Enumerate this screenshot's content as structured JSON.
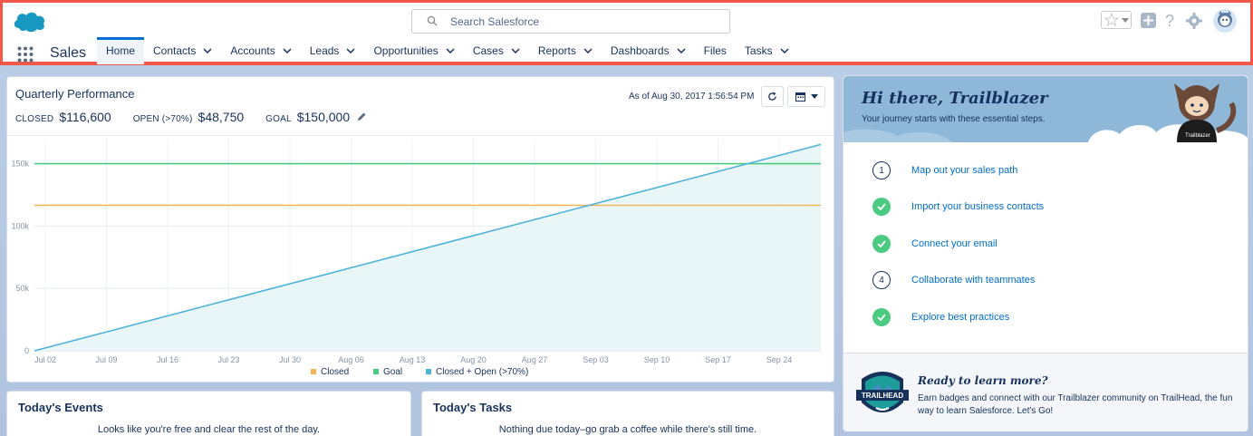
{
  "header": {
    "search_placeholder": "Search Salesforce",
    "app_name": "Sales",
    "utility_icons": [
      "star-icon",
      "plus-icon",
      "help-icon",
      "gear-icon",
      "avatar"
    ]
  },
  "nav": {
    "tabs": [
      {
        "label": "Home",
        "has_menu": false,
        "active": true
      },
      {
        "label": "Contacts",
        "has_menu": true
      },
      {
        "label": "Accounts",
        "has_menu": true
      },
      {
        "label": "Leads",
        "has_menu": true
      },
      {
        "label": "Opportunities",
        "has_menu": true
      },
      {
        "label": "Cases",
        "has_menu": true
      },
      {
        "label": "Reports",
        "has_menu": true
      },
      {
        "label": "Dashboards",
        "has_menu": true
      },
      {
        "label": "Files",
        "has_menu": false
      },
      {
        "label": "Tasks",
        "has_menu": true
      }
    ]
  },
  "performance": {
    "title": "Quarterly Performance",
    "closed_label": "CLOSED",
    "closed_value": "$116,600",
    "open_label": "OPEN (>70%)",
    "open_value": "$48,750",
    "goal_label": "GOAL",
    "goal_value": "$150,000",
    "as_of": "As of Aug 30, 2017 1:56:54 PM"
  },
  "chart_data": {
    "type": "line",
    "x": [
      "Jul 02",
      "Jul 09",
      "Jul 16",
      "Jul 23",
      "Jul 30",
      "Aug 06",
      "Aug 13",
      "Aug 20",
      "Aug 27",
      "Sep 03",
      "Sep 10",
      "Sep 17",
      "Sep 24"
    ],
    "yticks": [
      "0",
      "50k",
      "100k",
      "150k"
    ],
    "ylim": [
      0,
      170000
    ],
    "series": [
      {
        "name": "Closed",
        "color": "#f4b350",
        "points": [
          [
            0,
            116600
          ],
          [
            1,
            116600
          ]
        ]
      },
      {
        "name": "Goal",
        "color": "#4bca81",
        "points": [
          [
            0,
            150000
          ],
          [
            1,
            150000
          ]
        ]
      },
      {
        "name": "Closed + Open (>70%)",
        "color": "#4fb3d8",
        "points": [
          [
            0,
            0
          ],
          [
            1,
            165350
          ]
        ]
      }
    ],
    "grid": true,
    "legend_position": "bottom"
  },
  "events": {
    "title": "Today's Events",
    "message": "Looks like you're free and clear the rest of the day."
  },
  "tasks": {
    "title": "Today's Tasks",
    "message": "Nothing due today–go grab a coffee while there's still time."
  },
  "trailblazer": {
    "title": "Hi there, Trailblazer",
    "subtitle": "Your journey starts with these essential steps.",
    "steps": [
      {
        "num": "1",
        "done": false,
        "label": "Map out your sales path"
      },
      {
        "num": "2",
        "done": true,
        "label": "Import your business contacts"
      },
      {
        "num": "3",
        "done": true,
        "label": "Connect your email"
      },
      {
        "num": "4",
        "done": false,
        "label": "Collaborate with teammates"
      },
      {
        "num": "5",
        "done": true,
        "label": "Explore best practices"
      }
    ],
    "footer_title": "Ready to learn more?",
    "footer_text": "Earn badges and connect with our Trailblazer community on TrailHead, the fun way to learn Salesforce. Let's Go!",
    "badge_text": "TRAILHEAD",
    "mascot_shirt": "Trailblazer"
  }
}
